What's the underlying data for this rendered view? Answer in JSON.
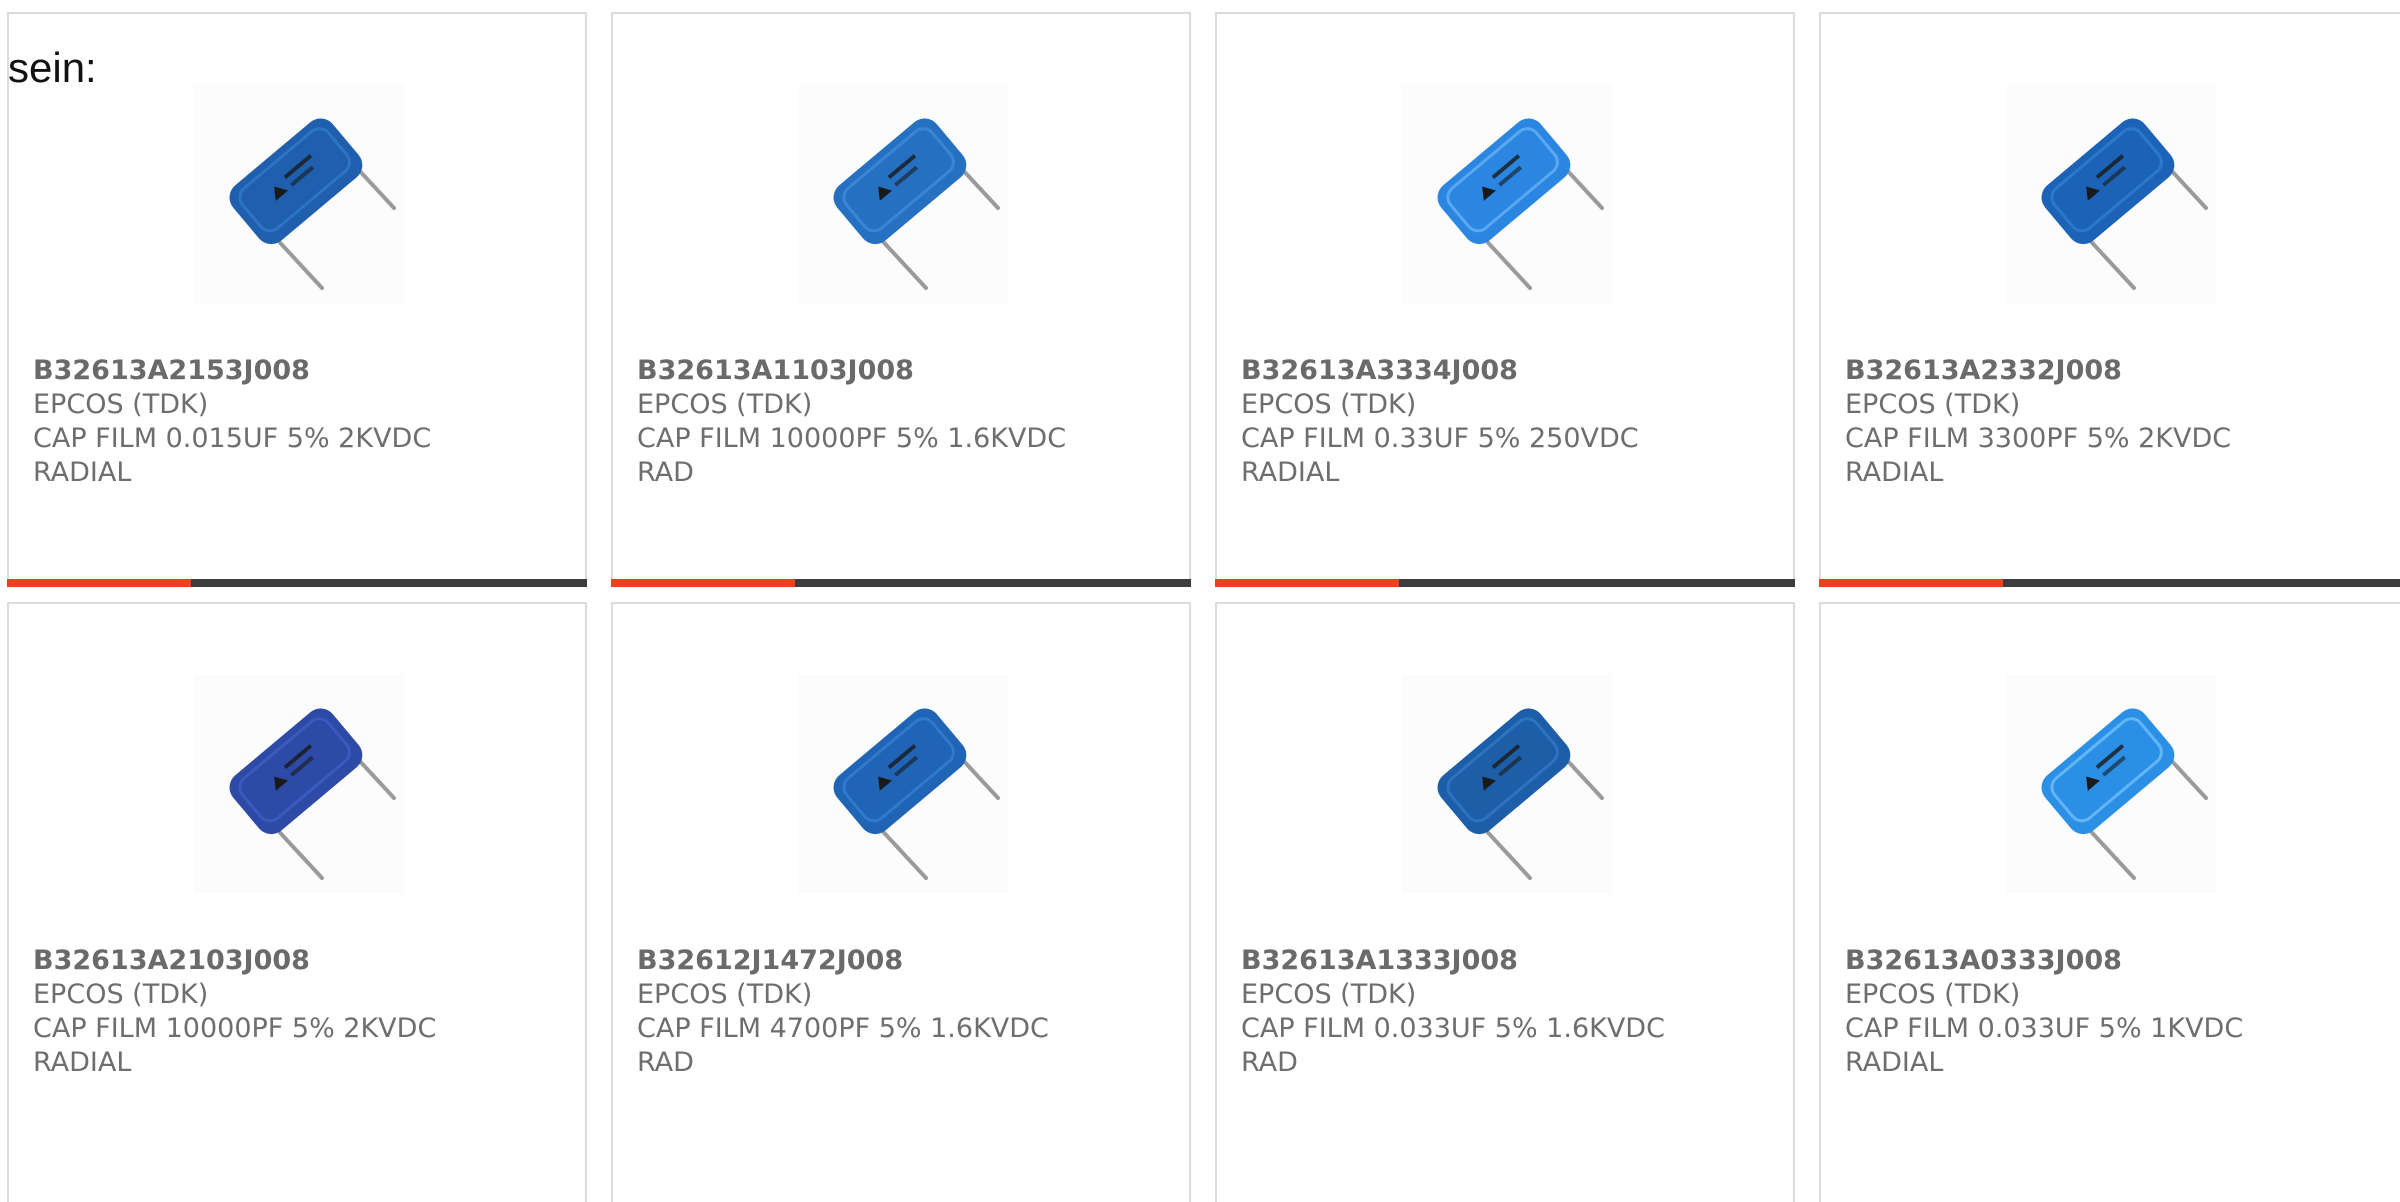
{
  "intro_text": "sein:",
  "colors": {
    "accent": "#e8431d",
    "bar_track": "#3d3d3d",
    "border": "#dcdcdc",
    "text": "#6e6e6e"
  },
  "products": [
    {
      "part": "B32613A2153J008",
      "manufacturer": "EPCOS (TDK)",
      "description": [
        "CAP FILM 0.015UF 5% 2KVDC",
        "RADIAL"
      ],
      "image_icon": "film-capacitor-image",
      "body_color": "#1f5fae",
      "highlight": "#2d74c6"
    },
    {
      "part": "B32613A1103J008",
      "manufacturer": "EPCOS (TDK)",
      "description": [
        "CAP FILM 10000PF 5% 1.6KVDC",
        "RAD"
      ],
      "image_icon": "film-capacitor-image",
      "body_color": "#2670c2",
      "highlight": "#3a86d6"
    },
    {
      "part": "B32613A3334J008",
      "manufacturer": "EPCOS (TDK)",
      "description": [
        "CAP FILM 0.33UF 5% 250VDC",
        "RADIAL"
      ],
      "image_icon": "film-capacitor-image",
      "body_color": "#2a86e0",
      "highlight": "#5aa8f0"
    },
    {
      "part": "B32613A2332J008",
      "manufacturer": "EPCOS (TDK)",
      "description": [
        "CAP FILM 3300PF 5% 2KVDC",
        "RADIAL"
      ],
      "image_icon": "film-capacitor-image",
      "body_color": "#1c63b8",
      "highlight": "#2c78cc"
    },
    {
      "part": "B32613A2103J008",
      "manufacturer": "EPCOS (TDK)",
      "description": [
        "CAP FILM 10000PF 5% 2KVDC",
        "RADIAL"
      ],
      "image_icon": "film-capacitor-image",
      "body_color": "#2d4aa6",
      "highlight": "#3a5bbd"
    },
    {
      "part": "B32612J1472J008",
      "manufacturer": "EPCOS (TDK)",
      "description": [
        "CAP FILM 4700PF 5% 1.6KVDC",
        "RAD"
      ],
      "image_icon": "film-capacitor-image",
      "body_color": "#1f64b5",
      "highlight": "#2f7acb"
    },
    {
      "part": "B32613A1333J008",
      "manufacturer": "EPCOS (TDK)",
      "description": [
        "CAP FILM 0.033UF 5% 1.6KVDC",
        "RAD"
      ],
      "image_icon": "film-capacitor-image",
      "body_color": "#1d5ea9",
      "highlight": "#2c73c2"
    },
    {
      "part": "B32613A0333J008",
      "manufacturer": "EPCOS (TDK)",
      "description": [
        "CAP FILM 0.033UF 5% 1KVDC",
        "RADIAL"
      ],
      "image_icon": "film-capacitor-image",
      "body_color": "#2b8fe6",
      "highlight": "#63b6f5"
    }
  ]
}
